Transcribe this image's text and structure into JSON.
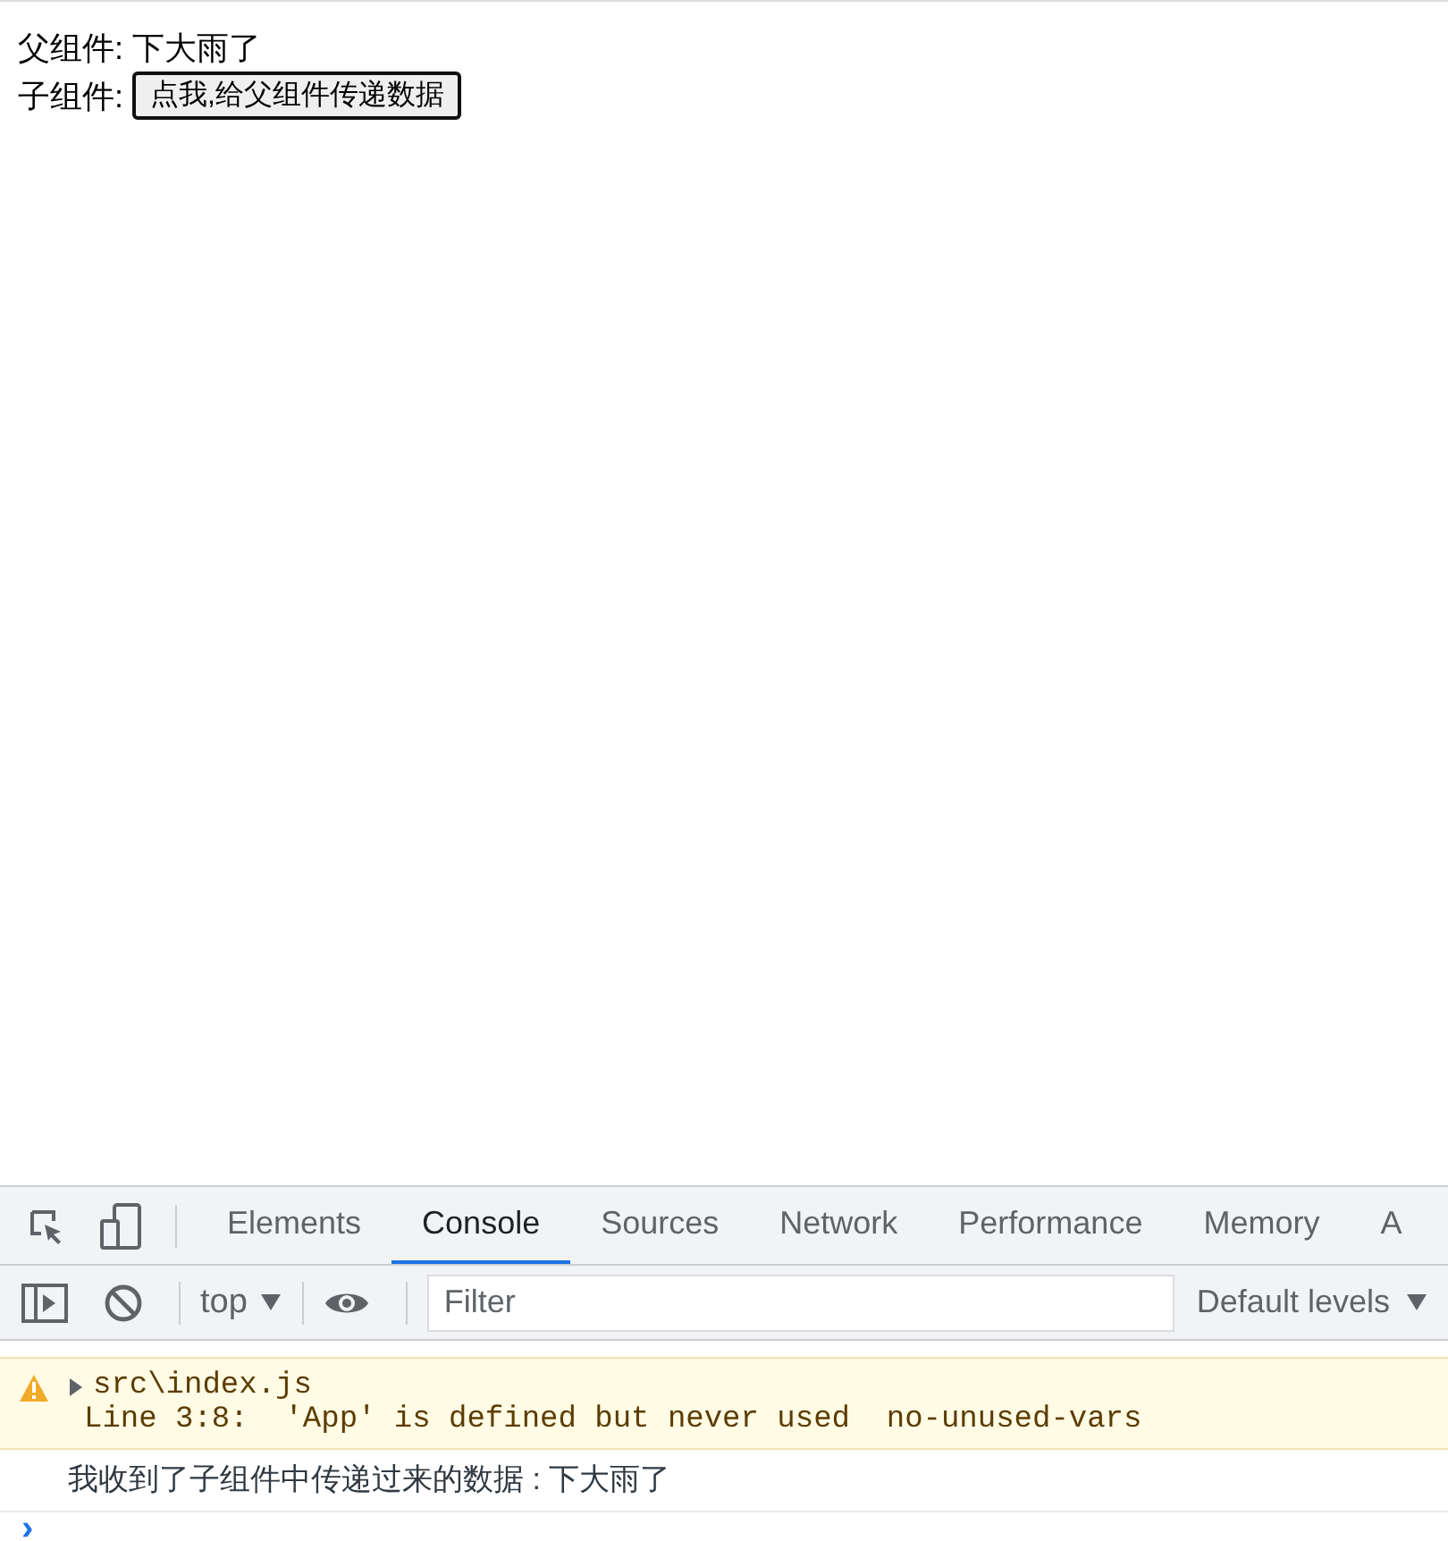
{
  "page": {
    "parent_label": "父组件:",
    "parent_value": "下大雨了",
    "child_label": "子组件:",
    "child_button": "点我,给父组件传递数据"
  },
  "devtools": {
    "tabs": [
      {
        "label": "Elements",
        "selected": false
      },
      {
        "label": "Console",
        "selected": true
      },
      {
        "label": "Sources",
        "selected": false
      },
      {
        "label": "Network",
        "selected": false
      },
      {
        "label": "Performance",
        "selected": false
      },
      {
        "label": "Memory",
        "selected": false
      },
      {
        "label": "A",
        "selected": false
      }
    ],
    "context": "top",
    "filter_placeholder": "Filter",
    "levels": "Default levels",
    "messages": [
      {
        "kind": "warning",
        "source": "src\\index.js",
        "text": "Line 3:8:  'App' is defined but never used  no-unused-vars"
      },
      {
        "kind": "log",
        "text": "我收到了子组件中传递过来的数据 : 下大雨了"
      }
    ],
    "prompt": "›"
  }
}
